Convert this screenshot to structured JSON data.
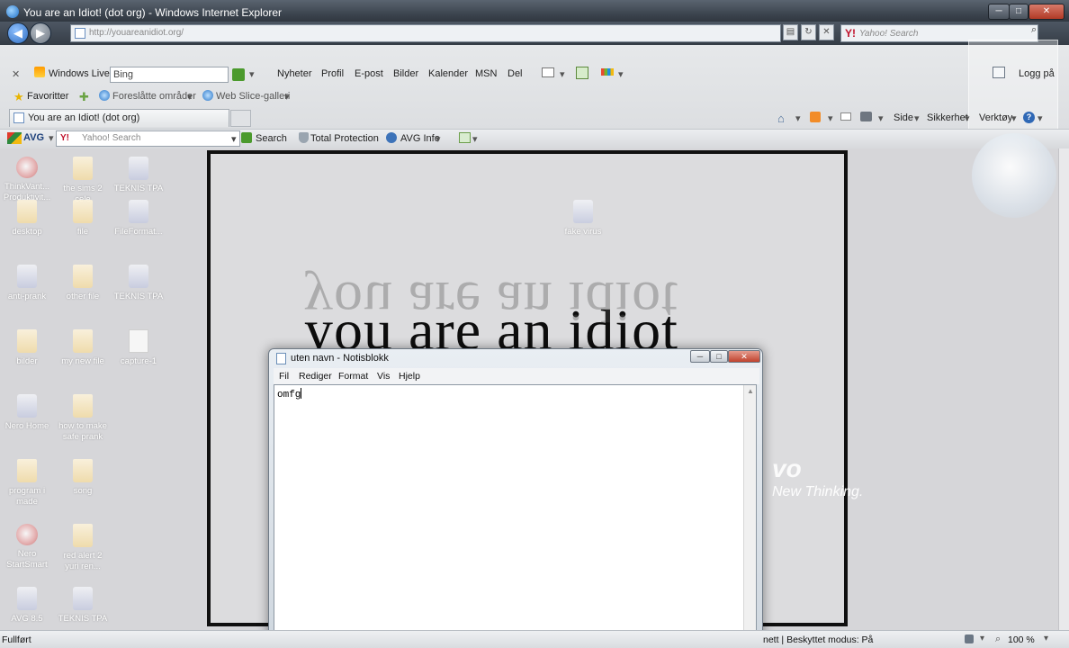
{
  "window": {
    "title": "You are an Idiot! (dot org) - Windows Internet Explorer",
    "min_label": "─",
    "max_label": "□",
    "close_label": "✕"
  },
  "address": {
    "url": "http://youareanidiot.org/",
    "search_placeholder": "Yahoo! Search"
  },
  "toolbar": {
    "close_x": "✕",
    "windows_live": "Windows Live",
    "bing_value": "Bing",
    "links": [
      "Nyheter",
      "Profil",
      "E-post",
      "Bilder",
      "Kalender",
      "MSN",
      "Del"
    ],
    "login": "Logg på"
  },
  "favorites": {
    "favorites_label": "Favoritter",
    "suggested_label": "Foreslåtte områder",
    "webslice_label": "Web Slice-galleri"
  },
  "tab": {
    "label": "You are an Idiot! (dot org)"
  },
  "command_bar": {
    "side": "Side",
    "sikkerhet": "Sikkerhet",
    "verktoy": "Verktøy"
  },
  "avg_bar": {
    "avg_label": "AVG",
    "search_placeholder": "Yahoo! Search",
    "search_btn": "Search",
    "total_protection": "Total Protection",
    "avg_info": "AVG Info"
  },
  "desktop_icons": [
    {
      "label": "ThinkVant... Produktivit...",
      "kind": "disc"
    },
    {
      "label": "the sims 2 cele",
      "kind": "folder"
    },
    {
      "label": "TEKNIS TPA",
      "kind": "app"
    },
    {
      "label": "desktop",
      "kind": "folder"
    },
    {
      "label": "file",
      "kind": "folder"
    },
    {
      "label": "FileFormat...",
      "kind": "app"
    },
    {
      "label": "anti-prank",
      "kind": "app"
    },
    {
      "label": "other file",
      "kind": "folder"
    },
    {
      "label": "TEKNIS TPA",
      "kind": "app"
    },
    {
      "label": "bilder",
      "kind": "folder"
    },
    {
      "label": "my new file",
      "kind": "folder"
    },
    {
      "label": "capture-1",
      "kind": "doc"
    },
    {
      "label": "Nero Home",
      "kind": "app"
    },
    {
      "label": "how to make safe prank",
      "kind": "folder"
    },
    {
      "label": "program i made",
      "kind": "folder"
    },
    {
      "label": "song",
      "kind": "folder"
    },
    {
      "label": "Nero StartSmart",
      "kind": "disc"
    },
    {
      "label": "red alert 2 yuri ren...",
      "kind": "folder"
    },
    {
      "label": "AVG 8.5",
      "kind": "app"
    },
    {
      "label": "TEKNIS TPA",
      "kind": "app"
    }
  ],
  "webpage": {
    "headline": "you are an idiot",
    "fake_virus_label": "fake virus"
  },
  "wallpaper": {
    "brand_fragment": "vo",
    "tagline": "New Thinking."
  },
  "notepad": {
    "title": "uten navn - Notisblokk",
    "menus": [
      "Fil",
      "Rediger",
      "Format",
      "Vis",
      "Hjelp"
    ],
    "content": "omfg"
  },
  "status": {
    "left": "Fullført",
    "mode": "nett | Beskyttet modus: På",
    "zoom": "100 %"
  }
}
